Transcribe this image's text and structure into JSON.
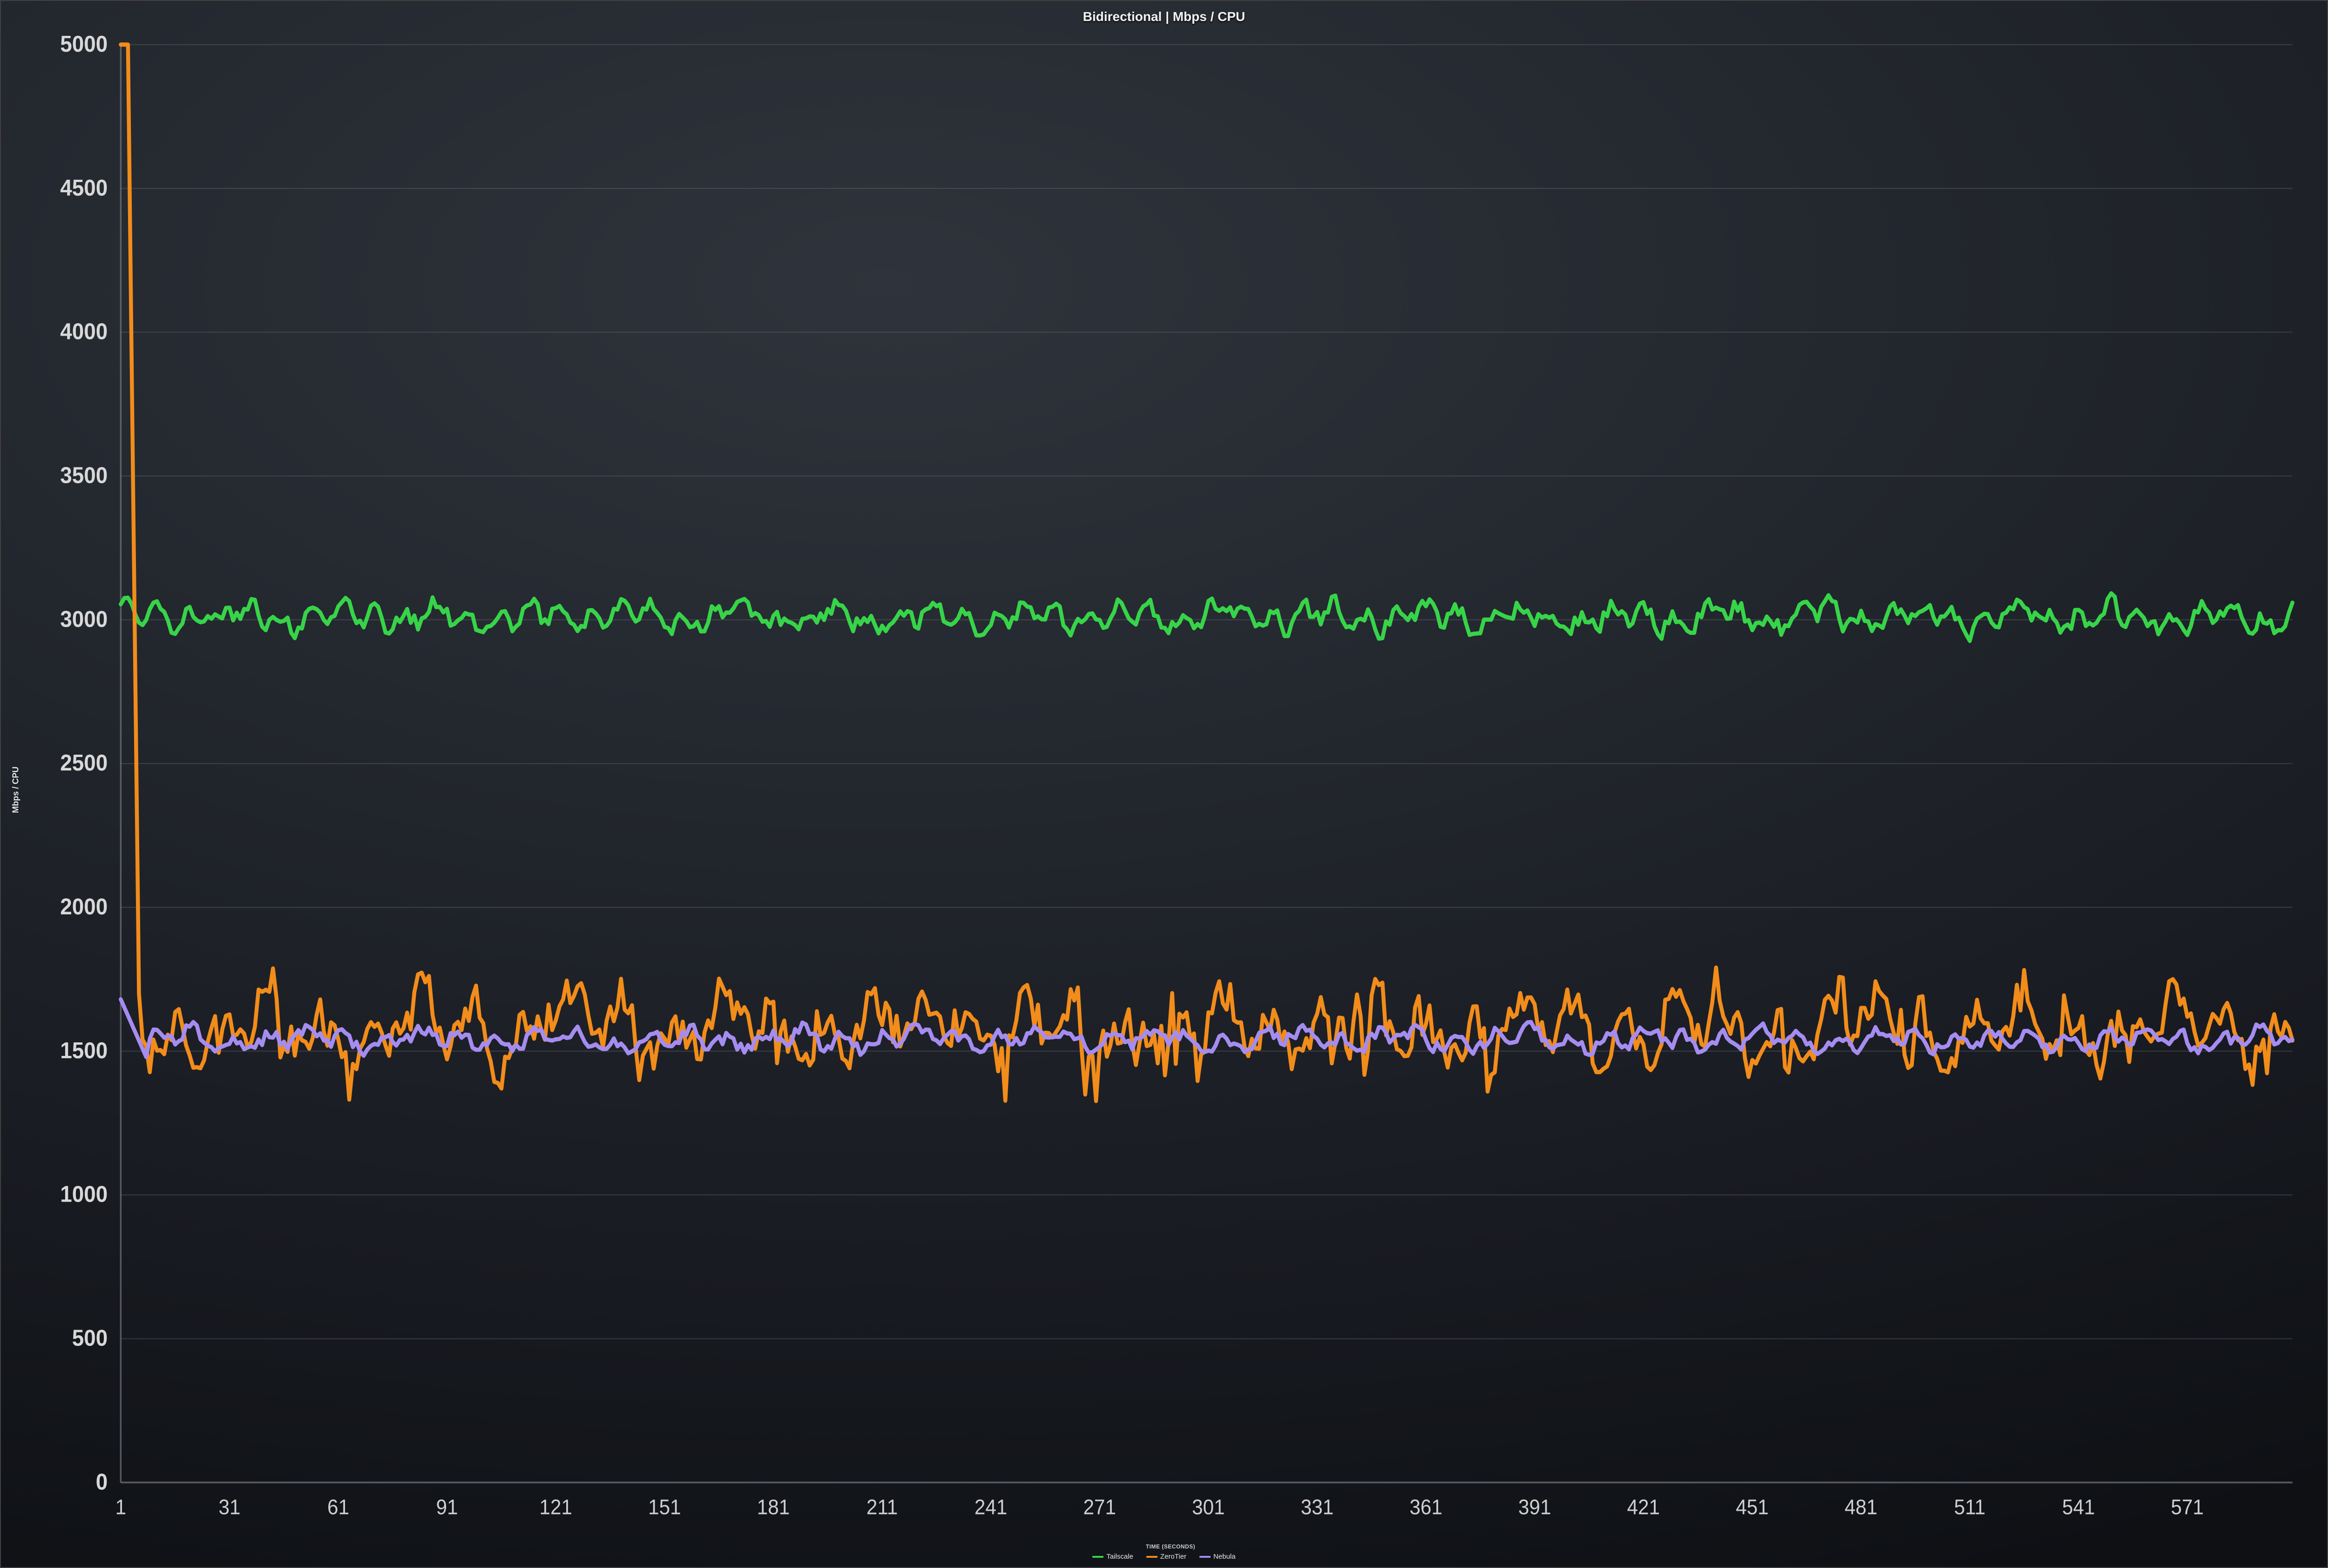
{
  "chart_data": {
    "type": "line",
    "title": "Bidirectional | Mbps / CPU",
    "xlabel": "TIME (SECONDS)",
    "ylabel": "Mbps / CPU",
    "ylim": [
      0,
      5000
    ],
    "xlim": [
      1,
      600
    ],
    "x_tick_start": 1,
    "x_tick_step": 30,
    "x_tick_count": 20,
    "y_tick_step": 500,
    "legend_position": "bottom",
    "grid": true,
    "colors": {
      "Tailscale": "#37d449",
      "ZeroTier": "#f28c1a",
      "Nebula": "#a58cf0"
    },
    "series": [
      {
        "name": "Tailscale",
        "mean": 3010,
        "jitter_amp": 70,
        "jitter_freq": 2.1,
        "special_points": []
      },
      {
        "name": "ZeroTier",
        "mean": 1580,
        "jitter_amp": 170,
        "jitter_freq": 1.3,
        "special_points": [
          {
            "x": 1,
            "y": 5000
          },
          {
            "x": 3,
            "y": 5000
          },
          {
            "x": 6,
            "y": 1700
          }
        ]
      },
      {
        "name": "Nebula",
        "mean": 1540,
        "jitter_amp": 55,
        "jitter_freq": 1.7,
        "special_points": [
          {
            "x": 1,
            "y": 1680
          },
          {
            "x": 8,
            "y": 1480
          }
        ]
      }
    ],
    "summary_values": {
      "Tailscale_typical": 3010,
      "ZeroTier_typical": 1580,
      "Nebula_typical": 1540,
      "ZeroTier_initial_spike": 5000
    }
  }
}
